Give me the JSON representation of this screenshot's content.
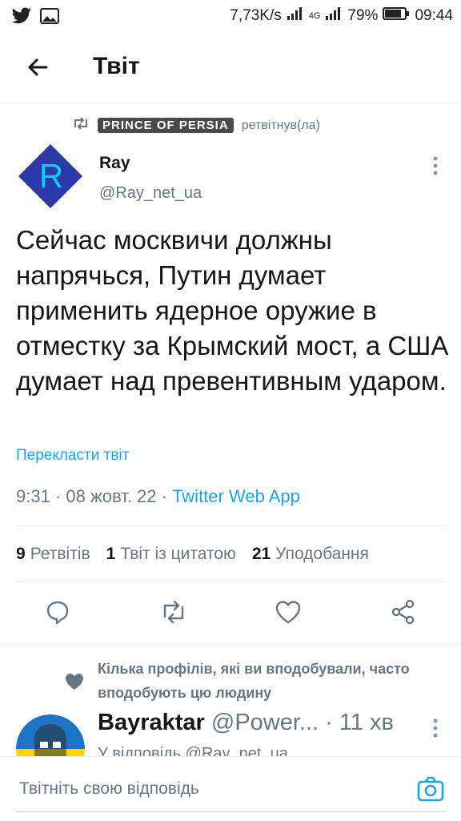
{
  "status_bar": {
    "speed": "7,73K/s",
    "network": "4G",
    "battery": "79%",
    "time": "09:44"
  },
  "appbar": {
    "title": "Твіт"
  },
  "retweet": {
    "by": "PRINCE OF PERSIA",
    "suffix": "ретвітнув(ла)"
  },
  "tweet": {
    "author_name": "Ray",
    "author_handle": "@Ray_net_ua",
    "avatar_letter": "R",
    "text": "Сейчас москвичи должны напрячься, Путин думает применить ядерное оружие в отместку за Крымский мост, а США думает над превентивным ударом.",
    "translate_label": "Перекласти твіт",
    "time": "9:31",
    "date": "08 жовт. 22",
    "source": "Twitter Web App"
  },
  "stats": {
    "retweets_count": "9",
    "retweets_label": "Ретвітів",
    "quotes_count": "1",
    "quotes_label": "Твіт із цитатою",
    "likes_count": "21",
    "likes_label": "Уподобання"
  },
  "recommendation": {
    "text": "Кілька профілів, які ви вподобували, часто вподобують цю людину"
  },
  "reply": {
    "name": "Bayraktar",
    "handle": "@Power...",
    "time": "· 11 хв",
    "sub": "У відповідь @Ray_net_ua"
  },
  "compose": {
    "placeholder": "Твітніть свою відповідь"
  },
  "colors": {
    "accent": "#1da1f2",
    "secondary_text": "#657786",
    "avatar_bg": "#2b3aa8"
  }
}
